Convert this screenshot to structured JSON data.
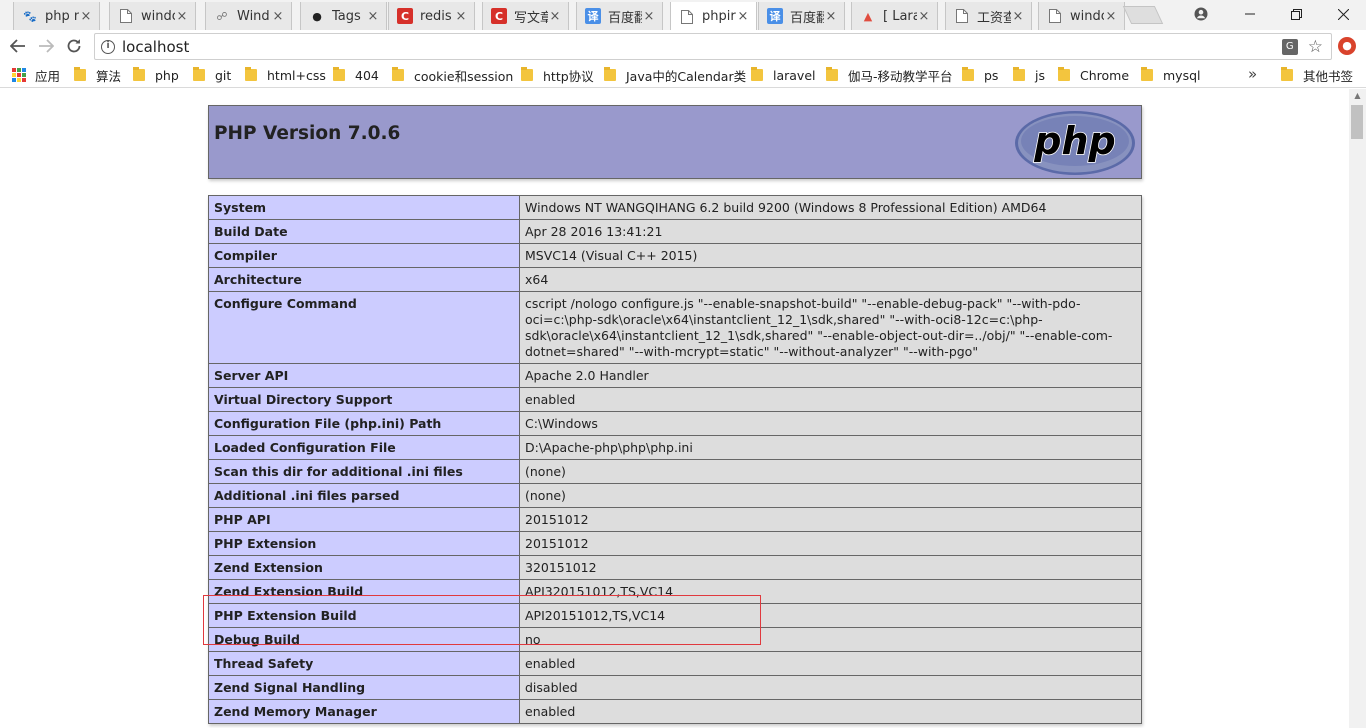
{
  "browser": {
    "tabs": [
      {
        "title": "php n",
        "favicon": "paw-icon",
        "favicon_color": "#2f6fe0",
        "active": false
      },
      {
        "title": "windo",
        "favicon": "doc-icon",
        "favicon_color": "#888888",
        "active": false
      },
      {
        "title": "Wind",
        "favicon": "rss-icon",
        "favicon_color": "#777777",
        "active": false
      },
      {
        "title": "Tags",
        "favicon": "github-icon",
        "favicon_color": "#222222",
        "active": false
      },
      {
        "title": "redis",
        "favicon": "csdn-icon",
        "favicon_color": "#d6302a",
        "active": false
      },
      {
        "title": "写文章",
        "favicon": "csdn-icon",
        "favicon_color": "#d6302a",
        "active": false
      },
      {
        "title": "百度翻",
        "favicon": "baidu-translate-icon",
        "favicon_color": "#4a8fe7",
        "active": false
      },
      {
        "title": "phpir",
        "favicon": "doc-icon",
        "favicon_color": "#888888",
        "active": true
      },
      {
        "title": "百度翻",
        "favicon": "baidu-translate-icon",
        "favicon_color": "#4a8fe7",
        "active": false
      },
      {
        "title": "[ Lara",
        "favicon": "laravel-icon",
        "favicon_color": "#e04d3f",
        "active": false
      },
      {
        "title": "工资查",
        "favicon": "doc-icon",
        "favicon_color": "#888888",
        "active": false
      },
      {
        "title": "windo",
        "favicon": "doc-icon",
        "favicon_color": "#888888",
        "active": false
      }
    ],
    "address": "localhost",
    "bookmarks": [
      {
        "label": "应用",
        "type": "apps"
      },
      {
        "label": "算法",
        "type": "folder"
      },
      {
        "label": "php",
        "type": "folder"
      },
      {
        "label": "git",
        "type": "folder"
      },
      {
        "label": "html+css",
        "type": "folder"
      },
      {
        "label": "404",
        "type": "folder"
      },
      {
        "label": "cookie和session",
        "type": "folder"
      },
      {
        "label": "http协议",
        "type": "folder"
      },
      {
        "label": "Java中的Calendar类",
        "type": "folder"
      },
      {
        "label": "laravel",
        "type": "folder"
      },
      {
        "label": "伽马-移动教学平台",
        "type": "folder"
      },
      {
        "label": "ps",
        "type": "folder"
      },
      {
        "label": "js",
        "type": "folder"
      },
      {
        "label": "Chrome",
        "type": "folder"
      },
      {
        "label": "mysql",
        "type": "folder"
      },
      {
        "label": "其他书签",
        "type": "folder"
      }
    ],
    "bookmarks_overflow": "»"
  },
  "php": {
    "version_title": "PHP Version 7.0.6",
    "logo_text": "php",
    "rows": [
      {
        "key": "System",
        "value": "Windows NT WANGQIHANG 6.2 build 9200 (Windows 8 Professional Edition) AMD64"
      },
      {
        "key": "Build Date",
        "value": "Apr 28 2016 13:41:21"
      },
      {
        "key": "Compiler",
        "value": "MSVC14 (Visual C++ 2015)"
      },
      {
        "key": "Architecture",
        "value": "x64"
      },
      {
        "key": "Configure Command",
        "value": "cscript /nologo configure.js \"--enable-snapshot-build\" \"--enable-debug-pack\" \"--with-pdo-oci=c:\\php-sdk\\oracle\\x64\\instantclient_12_1\\sdk,shared\" \"--with-oci8-12c=c:\\php-sdk\\oracle\\x64\\instantclient_12_1\\sdk,shared\" \"--enable-object-out-dir=../obj/\" \"--enable-com-dotnet=shared\" \"--with-mcrypt=static\" \"--without-analyzer\" \"--with-pgo\""
      },
      {
        "key": "Server API",
        "value": "Apache 2.0 Handler"
      },
      {
        "key": "Virtual Directory Support",
        "value": "enabled"
      },
      {
        "key": "Configuration File (php.ini) Path",
        "value": "C:\\Windows"
      },
      {
        "key": "Loaded Configuration File",
        "value": "D:\\Apache-php\\php\\php.ini"
      },
      {
        "key": "Scan this dir for additional .ini files",
        "value": "(none)"
      },
      {
        "key": "Additional .ini files parsed",
        "value": "(none)"
      },
      {
        "key": "PHP API",
        "value": "20151012"
      },
      {
        "key": "PHP Extension",
        "value": "20151012"
      },
      {
        "key": "Zend Extension",
        "value": "320151012"
      },
      {
        "key": "Zend Extension Build",
        "value": "API320151012,TS,VC14"
      },
      {
        "key": "PHP Extension Build",
        "value": "API20151012,TS,VC14"
      },
      {
        "key": "Debug Build",
        "value": "no"
      },
      {
        "key": "Thread Safety",
        "value": "enabled"
      },
      {
        "key": "Zend Signal Handling",
        "value": "disabled"
      },
      {
        "key": "Zend Memory Manager",
        "value": "enabled"
      }
    ]
  },
  "colors": {
    "header_bg": "#9999cc",
    "key_bg": "#ccccff",
    "value_bg": "#dddddd",
    "highlight": "#e0393e"
  }
}
